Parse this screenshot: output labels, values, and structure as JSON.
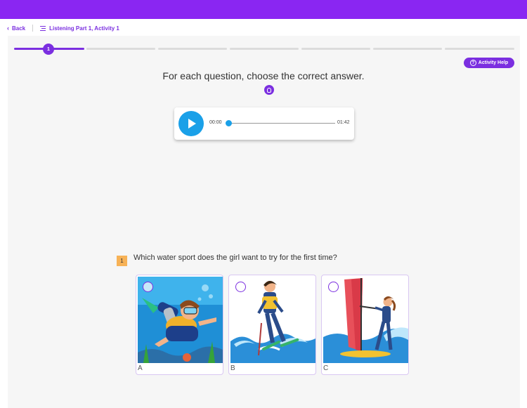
{
  "nav": {
    "back_label": "Back",
    "activity_title": "Listening Part 1, Activity 1"
  },
  "progress": {
    "current_step": "1",
    "total_segments": 7,
    "active_segments": 1
  },
  "help": {
    "label": "Activity Help"
  },
  "instruction": "For each question, choose the correct answer.",
  "audio": {
    "current_time": "00:00",
    "duration": "01:42",
    "progress": 0
  },
  "question": {
    "number": "1",
    "text": "Which water sport does the girl want to try for the first time?",
    "options": [
      {
        "letter": "A",
        "image": "scuba-diving-illustration"
      },
      {
        "letter": "B",
        "image": "water-skiing-illustration"
      },
      {
        "letter": "C",
        "image": "windsurfing-illustration"
      }
    ]
  },
  "colors": {
    "brand": "#8a26f2",
    "accent": "#7b2fe0",
    "play": "#1aa0e8",
    "question_badge": "#f7b257"
  }
}
